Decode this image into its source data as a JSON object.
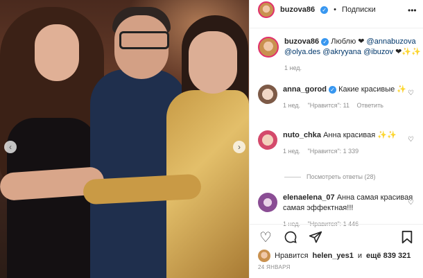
{
  "header": {
    "username": "buzova86",
    "separator": "•",
    "follow_label": "Подписки"
  },
  "caption": {
    "username": "buzova86",
    "text_prefix": "Люблю ❤",
    "mentions": [
      "@annabuzova",
      "@olya.des",
      "@akryyana",
      "@ibuzov"
    ],
    "suffix": "❤✨✨",
    "time": "1 нед."
  },
  "comments": [
    {
      "username": "anna_gorod",
      "text": "Какие красивые",
      "emoji": "✨",
      "time": "1 нед.",
      "likes": "\"Нравится\": 11",
      "reply": "Ответить"
    },
    {
      "username": "nuto_chka",
      "text": "Анна красивая",
      "emoji": "✨✨",
      "time": "1 нед.",
      "likes": "\"Нравится\": 1 339",
      "reply": ""
    },
    {
      "username": "elenaelena_07",
      "text": "Анна самая красивая самая эффектная!!!",
      "time": "1 нед.",
      "likes": "\"Нравится\": 1 446",
      "reply": ""
    }
  ],
  "view_replies": "Посмотреть ответы (28)",
  "likes_line": {
    "prefix": "Нравится",
    "user": "helen_yes1",
    "middle": "и",
    "count": "ещё 839 321"
  },
  "date": "24 ЯНВАРЯ",
  "colors": {
    "verified": "#3897f0",
    "mention": "#00376b",
    "meta": "#8e8e8e"
  }
}
